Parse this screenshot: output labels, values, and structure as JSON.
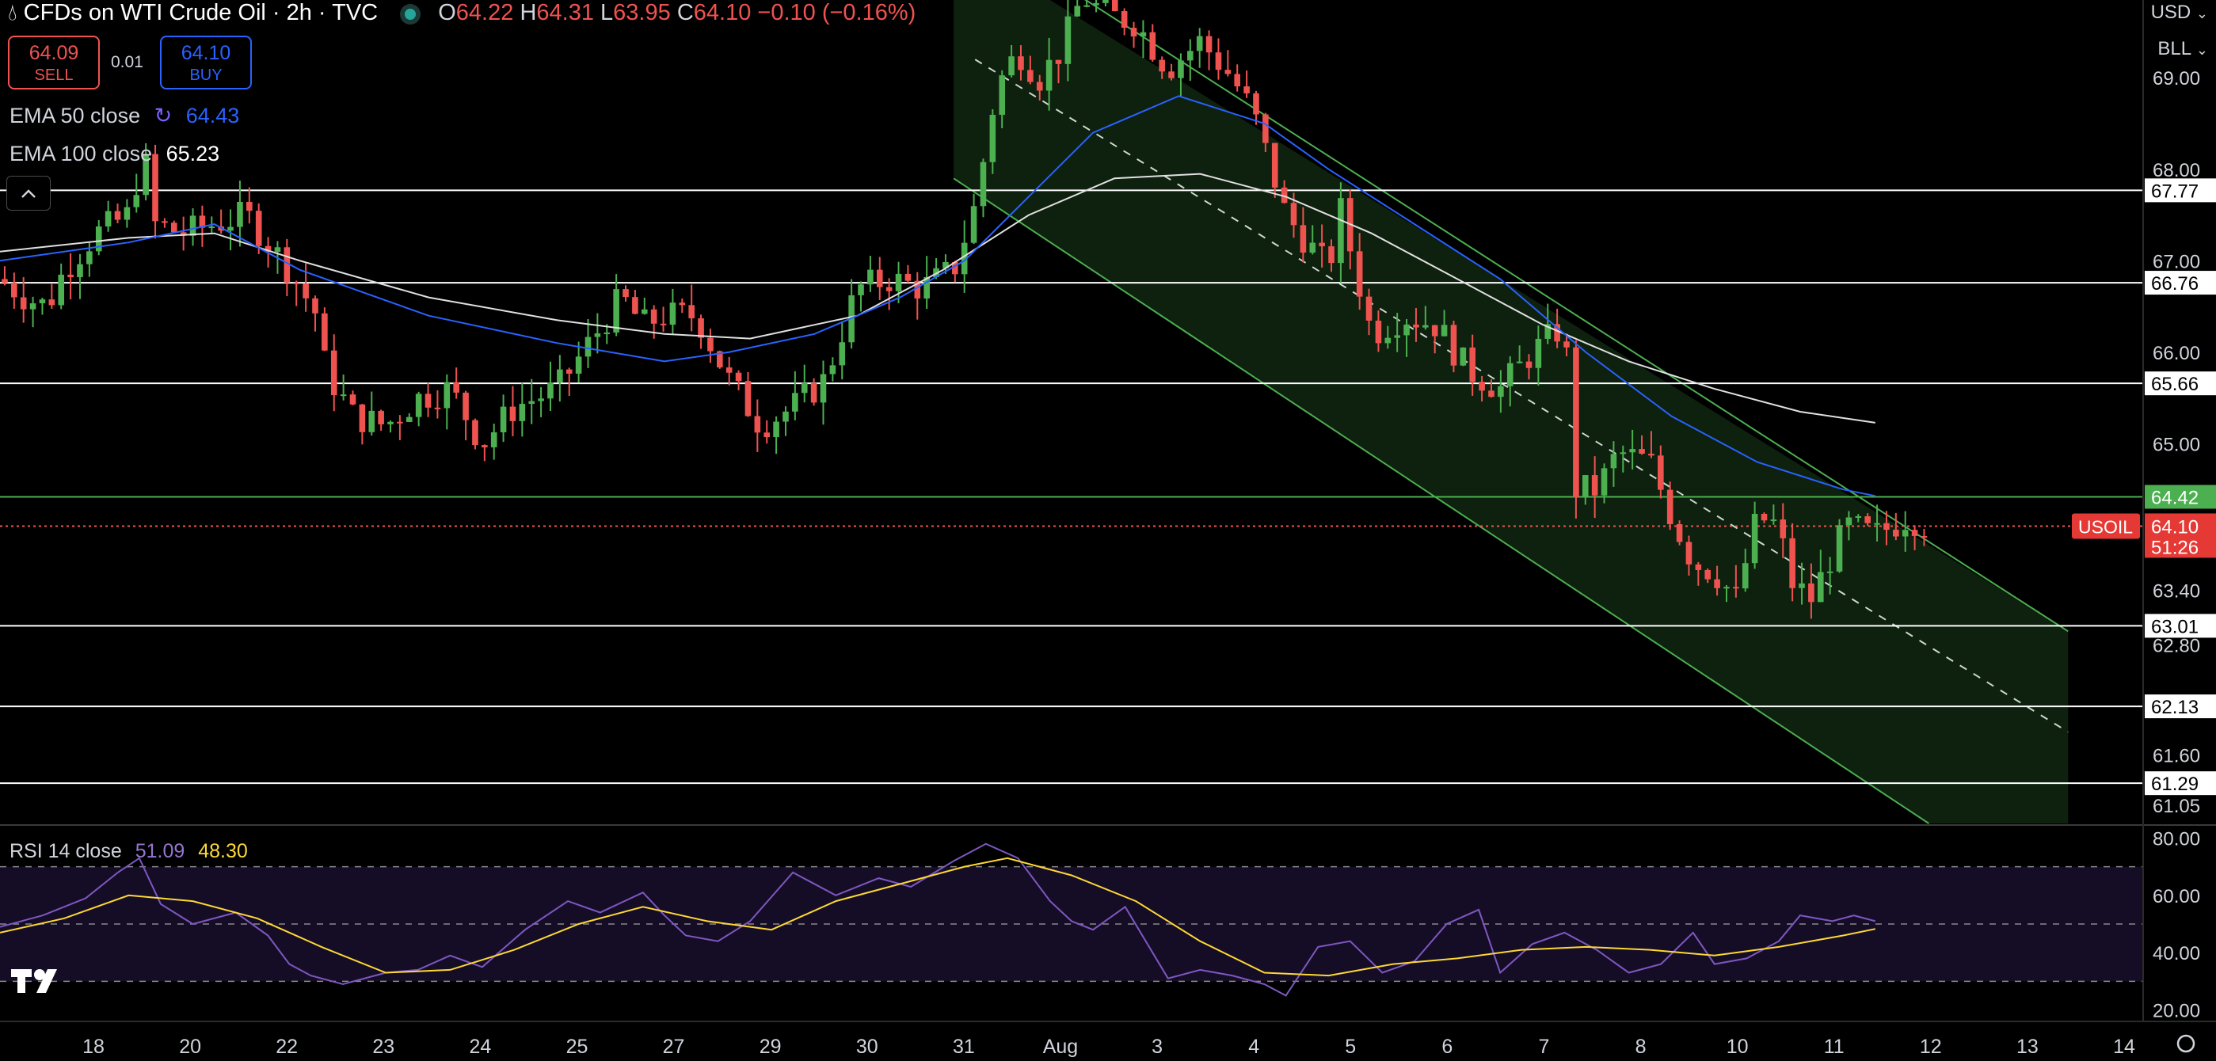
{
  "header": {
    "symbol_title": "CFDs on WTI Crude Oil · 2h · TVC",
    "ohlc": {
      "O": "64.22",
      "H": "64.31",
      "L": "63.95",
      "C": "64.10",
      "change": "−0.10 (−0.16%)"
    },
    "open_label": "O",
    "high_label": "H",
    "low_label": "L",
    "close_label": "C"
  },
  "trade": {
    "sell_price": "64.09",
    "sell_label": "SELL",
    "spread": "0.01",
    "buy_price": "64.10",
    "buy_label": "BUY"
  },
  "indicators": {
    "ema50_label": "EMA 50 close",
    "ema50_value": "64.43",
    "ema100_label": "EMA 100 close",
    "ema100_value": "65.23",
    "rsi_label": "RSI 14 close",
    "rsi_value": "51.09",
    "rsi_ma_value": "48.30"
  },
  "top_right": {
    "currency": "USD",
    "scale": "BLL"
  },
  "colors": {
    "up": "#26a69a",
    "up_body": "#4caf50",
    "down": "#ef5350",
    "ema50": "#2962ff",
    "ema100": "#e0e0e0",
    "rsi": "#7e57c2",
    "rsi_ma": "#fdd835",
    "channel": "#4caf50"
  },
  "chart_data": [
    {
      "type": "candlestick",
      "title": "CFDs on WTI Crude Oil · 2h · TVC",
      "y_axis_ticks": [
        "69.00",
        "68.00",
        "67.00",
        "66.00",
        "65.00",
        "63.40",
        "62.80",
        "61.60",
        "61.05"
      ],
      "x_axis_ticks": [
        "18",
        "20",
        "22",
        "23",
        "24",
        "25",
        "27",
        "29",
        "30",
        "31",
        "Aug",
        "3",
        "4",
        "5",
        "6",
        "7",
        "8",
        "10",
        "11",
        "12",
        "13",
        "14"
      ],
      "horizontal_levels": [
        {
          "value": 67.77,
          "label": "67.77"
        },
        {
          "value": 66.76,
          "label": "66.76"
        },
        {
          "value": 65.66,
          "label": "65.66"
        },
        {
          "value": 63.01,
          "label": "63.01"
        },
        {
          "value": 62.13,
          "label": "62.13"
        },
        {
          "value": 61.29,
          "label": "61.29"
        }
      ],
      "green_level": {
        "value": 64.42,
        "label": "64.42"
      },
      "last_price": {
        "symbol": "USOIL",
        "value": 64.1,
        "label": "64.10",
        "countdown": "51:26"
      },
      "ylim": [
        60.85,
        69.85
      ],
      "x_range": [
        0,
        1.0
      ],
      "price_path": [
        [
          0,
          66.8
        ],
        [
          0.012,
          66.6
        ],
        [
          0.022,
          66.5
        ],
        [
          0.03,
          66.9
        ],
        [
          0.045,
          67.3
        ],
        [
          0.06,
          67.5
        ],
        [
          0.067,
          68.2
        ],
        [
          0.072,
          67.4
        ],
        [
          0.085,
          67.3
        ],
        [
          0.1,
          67.4
        ],
        [
          0.115,
          67.5
        ],
        [
          0.125,
          67.2
        ],
        [
          0.135,
          66.9
        ],
        [
          0.148,
          66.4
        ],
        [
          0.152,
          65.8
        ],
        [
          0.165,
          65.3
        ],
        [
          0.18,
          65.2
        ],
        [
          0.195,
          65.5
        ],
        [
          0.21,
          65.6
        ],
        [
          0.225,
          65.0
        ],
        [
          0.24,
          65.4
        ],
        [
          0.26,
          65.6
        ],
        [
          0.275,
          66.1
        ],
        [
          0.29,
          66.6
        ],
        [
          0.3,
          66.3
        ],
        [
          0.31,
          66.4
        ],
        [
          0.325,
          66.4
        ],
        [
          0.34,
          65.7
        ],
        [
          0.355,
          65.2
        ],
        [
          0.37,
          65.4
        ],
        [
          0.385,
          65.7
        ],
        [
          0.4,
          66.7
        ],
        [
          0.415,
          66.8
        ],
        [
          0.43,
          66.7
        ],
        [
          0.445,
          66.9
        ],
        [
          0.455,
          67.6
        ],
        [
          0.465,
          68.9
        ],
        [
          0.475,
          69.3
        ],
        [
          0.485,
          69.0
        ],
        [
          0.495,
          69.3
        ],
        [
          0.505,
          69.9
        ],
        [
          0.515,
          69.7
        ],
        [
          0.53,
          69.6
        ],
        [
          0.545,
          69.1
        ],
        [
          0.56,
          69.4
        ],
        [
          0.575,
          69.0
        ],
        [
          0.585,
          68.6
        ],
        [
          0.6,
          67.5
        ],
        [
          0.61,
          67.2
        ],
        [
          0.62,
          66.9
        ],
        [
          0.625,
          67.6
        ],
        [
          0.64,
          66.2
        ],
        [
          0.655,
          66.4
        ],
        [
          0.67,
          66.3
        ],
        [
          0.685,
          65.8
        ],
        [
          0.7,
          65.6
        ],
        [
          0.715,
          66.0
        ],
        [
          0.73,
          66.3
        ],
        [
          0.735,
          64.5
        ],
        [
          0.745,
          64.5
        ],
        [
          0.755,
          64.9
        ],
        [
          0.77,
          64.8
        ],
        [
          0.78,
          64.2
        ],
        [
          0.79,
          63.7
        ],
        [
          0.8,
          63.6
        ],
        [
          0.81,
          63.3
        ],
        [
          0.82,
          64.2
        ],
        [
          0.83,
          64.1
        ],
        [
          0.835,
          63.5
        ],
        [
          0.845,
          63.3
        ],
        [
          0.855,
          63.8
        ],
        [
          0.862,
          64.1
        ],
        [
          0.875,
          64.0
        ],
        [
          0.89,
          64.2
        ],
        [
          0.9,
          64.1
        ]
      ],
      "ema50_path": [
        [
          0,
          67.0
        ],
        [
          0.06,
          67.2
        ],
        [
          0.1,
          67.4
        ],
        [
          0.14,
          66.9
        ],
        [
          0.2,
          66.4
        ],
        [
          0.26,
          66.1
        ],
        [
          0.31,
          65.9
        ],
        [
          0.34,
          66.0
        ],
        [
          0.38,
          66.2
        ],
        [
          0.42,
          66.6
        ],
        [
          0.45,
          67.0
        ],
        [
          0.48,
          67.7
        ],
        [
          0.51,
          68.4
        ],
        [
          0.55,
          68.8
        ],
        [
          0.59,
          68.5
        ],
        [
          0.62,
          68.0
        ],
        [
          0.66,
          67.4
        ],
        [
          0.7,
          66.8
        ],
        [
          0.74,
          66.0
        ],
        [
          0.78,
          65.3
        ],
        [
          0.82,
          64.8
        ],
        [
          0.86,
          64.5
        ],
        [
          0.875,
          64.43
        ]
      ],
      "ema100_path": [
        [
          0,
          67.1
        ],
        [
          0.06,
          67.25
        ],
        [
          0.1,
          67.3
        ],
        [
          0.14,
          67.0
        ],
        [
          0.2,
          66.6
        ],
        [
          0.26,
          66.35
        ],
        [
          0.31,
          66.2
        ],
        [
          0.35,
          66.15
        ],
        [
          0.4,
          66.4
        ],
        [
          0.44,
          66.9
        ],
        [
          0.48,
          67.5
        ],
        [
          0.52,
          67.9
        ],
        [
          0.56,
          67.95
        ],
        [
          0.6,
          67.7
        ],
        [
          0.64,
          67.3
        ],
        [
          0.68,
          66.8
        ],
        [
          0.72,
          66.3
        ],
        [
          0.76,
          65.9
        ],
        [
          0.8,
          65.6
        ],
        [
          0.84,
          65.35
        ],
        [
          0.875,
          65.23
        ]
      ],
      "channel": {
        "upper": [
          [
            0.49,
            70.1
          ],
          [
            0.965,
            62.95
          ]
        ],
        "lower": [
          [
            0.445,
            67.9
          ],
          [
            0.9,
            60.85
          ]
        ],
        "mid": [
          [
            0.455,
            69.2
          ],
          [
            0.965,
            61.85
          ]
        ]
      }
    },
    {
      "type": "line",
      "title": "RSI 14 close",
      "y_axis_ticks": [
        "80.00",
        "60.00",
        "40.00",
        "20.00"
      ],
      "ylim": [
        16,
        84
      ],
      "bands": [
        70,
        50,
        30
      ],
      "rsi_path": [
        [
          0,
          49
        ],
        [
          0.02,
          53
        ],
        [
          0.04,
          59
        ],
        [
          0.055,
          68
        ],
        [
          0.065,
          73
        ],
        [
          0.075,
          57
        ],
        [
          0.09,
          50
        ],
        [
          0.11,
          54
        ],
        [
          0.125,
          46
        ],
        [
          0.135,
          36
        ],
        [
          0.145,
          32
        ],
        [
          0.16,
          29
        ],
        [
          0.18,
          33
        ],
        [
          0.195,
          34
        ],
        [
          0.21,
          39
        ],
        [
          0.225,
          35
        ],
        [
          0.245,
          48
        ],
        [
          0.265,
          58
        ],
        [
          0.28,
          54
        ],
        [
          0.3,
          61
        ],
        [
          0.31,
          53
        ],
        [
          0.32,
          46
        ],
        [
          0.335,
          44
        ],
        [
          0.35,
          51
        ],
        [
          0.37,
          68
        ],
        [
          0.39,
          60
        ],
        [
          0.41,
          66
        ],
        [
          0.425,
          63
        ],
        [
          0.445,
          72
        ],
        [
          0.46,
          78
        ],
        [
          0.475,
          73
        ],
        [
          0.49,
          58
        ],
        [
          0.5,
          51
        ],
        [
          0.51,
          48
        ],
        [
          0.525,
          56
        ],
        [
          0.545,
          31
        ],
        [
          0.56,
          34
        ],
        [
          0.575,
          32
        ],
        [
          0.59,
          29
        ],
        [
          0.6,
          25
        ],
        [
          0.615,
          42
        ],
        [
          0.63,
          44
        ],
        [
          0.645,
          33
        ],
        [
          0.66,
          37
        ],
        [
          0.675,
          50
        ],
        [
          0.69,
          55
        ],
        [
          0.7,
          33
        ],
        [
          0.715,
          43
        ],
        [
          0.73,
          47
        ],
        [
          0.745,
          41
        ],
        [
          0.76,
          33
        ],
        [
          0.775,
          36
        ],
        [
          0.79,
          47
        ],
        [
          0.8,
          36
        ],
        [
          0.815,
          38
        ],
        [
          0.83,
          44
        ],
        [
          0.84,
          53
        ],
        [
          0.855,
          51
        ],
        [
          0.865,
          53
        ],
        [
          0.875,
          51
        ]
      ],
      "rsi_ma_path": [
        [
          0,
          47
        ],
        [
          0.03,
          52
        ],
        [
          0.06,
          60
        ],
        [
          0.09,
          58
        ],
        [
          0.12,
          52
        ],
        [
          0.15,
          42
        ],
        [
          0.18,
          33
        ],
        [
          0.21,
          34
        ],
        [
          0.24,
          41
        ],
        [
          0.27,
          50
        ],
        [
          0.3,
          56
        ],
        [
          0.33,
          51
        ],
        [
          0.36,
          48
        ],
        [
          0.39,
          58
        ],
        [
          0.42,
          64
        ],
        [
          0.45,
          70
        ],
        [
          0.47,
          73
        ],
        [
          0.5,
          67
        ],
        [
          0.53,
          58
        ],
        [
          0.56,
          44
        ],
        [
          0.59,
          33
        ],
        [
          0.62,
          32
        ],
        [
          0.65,
          36
        ],
        [
          0.68,
          38
        ],
        [
          0.71,
          41
        ],
        [
          0.74,
          42
        ],
        [
          0.77,
          41
        ],
        [
          0.8,
          39
        ],
        [
          0.83,
          42
        ],
        [
          0.86,
          46
        ],
        [
          0.875,
          48.3
        ]
      ]
    }
  ]
}
